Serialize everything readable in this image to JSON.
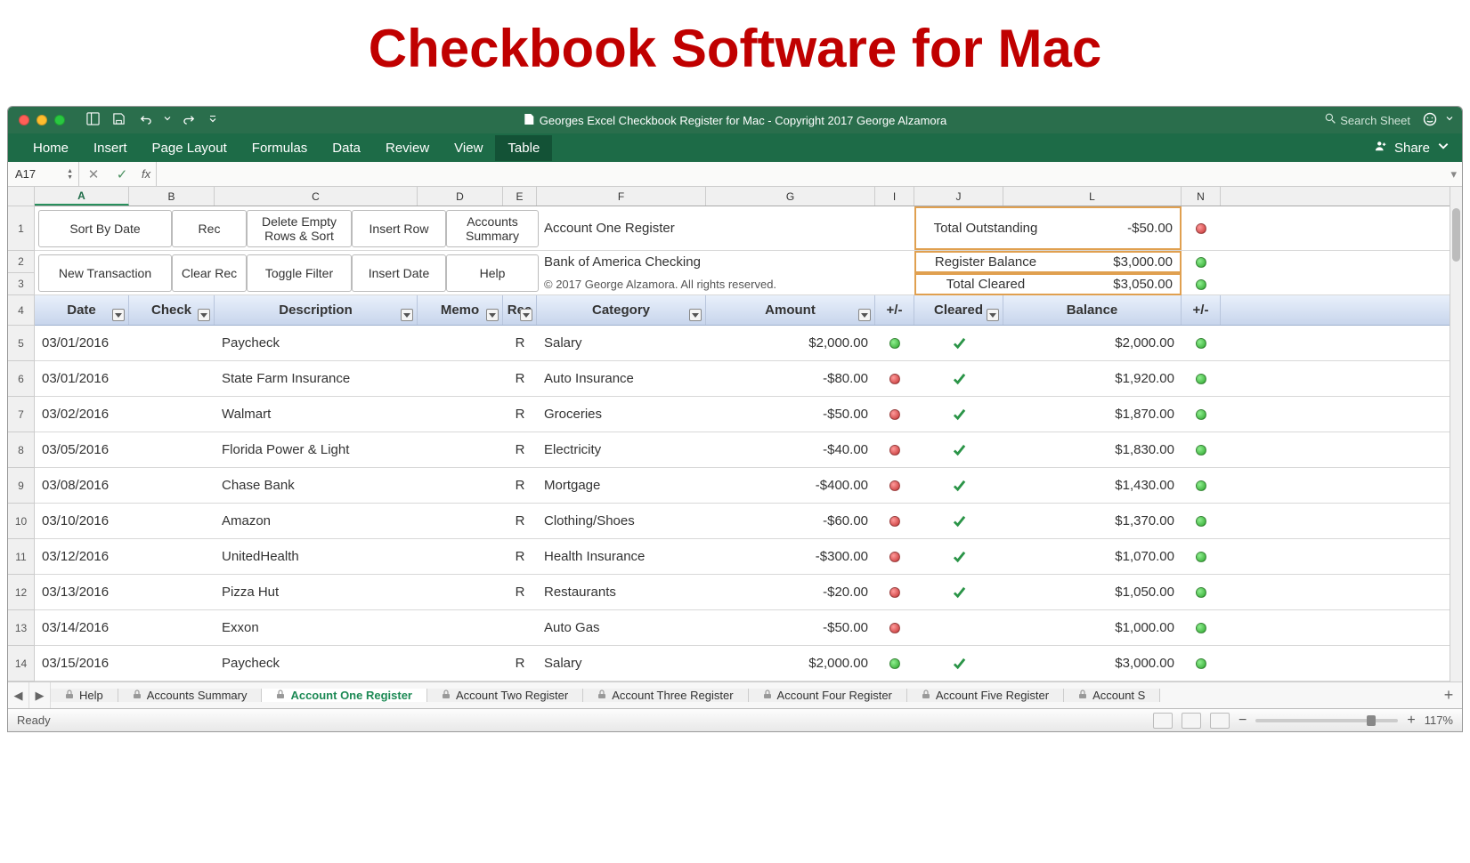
{
  "page_heading": "Checkbook Software for Mac",
  "window_title": "Georges Excel Checkbook Register for Mac - Copyright 2017 George Alzamora",
  "search_placeholder": "Search Sheet",
  "share_label": "Share",
  "ribbon_tabs": [
    "Home",
    "Insert",
    "Page Layout",
    "Formulas",
    "Data",
    "Review",
    "View",
    "Table"
  ],
  "active_ribbon_tab": "Table",
  "name_box": "A17",
  "col_headers": [
    "A",
    "B",
    "C",
    "D",
    "E",
    "F",
    "G",
    "I",
    "J",
    "L",
    "N"
  ],
  "buttons_row1": [
    "Sort By Date",
    "Rec",
    "Delete Empty Rows & Sort",
    "Insert Row",
    "Accounts Summary"
  ],
  "buttons_row2": [
    "New Transaction",
    "Clear Rec",
    "Toggle Filter",
    "Insert Date",
    "Help"
  ],
  "info_lines": {
    "title": "Account One Register",
    "bank": "Bank of America Checking",
    "copyright": "© 2017 George Alzamora.  All rights reserved."
  },
  "summary": [
    {
      "label": "Total Outstanding",
      "value": "-$50.00",
      "led": "red"
    },
    {
      "label": "Register Balance",
      "value": "$3,000.00",
      "led": "green"
    },
    {
      "label": "Total Cleared",
      "value": "$3,050.00",
      "led": "green"
    }
  ],
  "table_headers": [
    "Date",
    "Check",
    "Description",
    "Memo",
    "Rec",
    "Category",
    "Amount",
    "+/-",
    "Cleared",
    "Balance",
    "+/-"
  ],
  "rows": [
    {
      "date": "03/01/2016",
      "check": "",
      "desc": "Paycheck",
      "memo": "",
      "rec": "R",
      "cat": "Salary",
      "amt": "$2,000.00",
      "pm": "green",
      "clr": true,
      "bal": "$2,000.00",
      "pm2": "green"
    },
    {
      "date": "03/01/2016",
      "check": "",
      "desc": "State Farm Insurance",
      "memo": "",
      "rec": "R",
      "cat": "Auto Insurance",
      "amt": "-$80.00",
      "pm": "red",
      "clr": true,
      "bal": "$1,920.00",
      "pm2": "green"
    },
    {
      "date": "03/02/2016",
      "check": "",
      "desc": "Walmart",
      "memo": "",
      "rec": "R",
      "cat": "Groceries",
      "amt": "-$50.00",
      "pm": "red",
      "clr": true,
      "bal": "$1,870.00",
      "pm2": "green"
    },
    {
      "date": "03/05/2016",
      "check": "",
      "desc": "Florida Power & Light",
      "memo": "",
      "rec": "R",
      "cat": "Electricity",
      "amt": "-$40.00",
      "pm": "red",
      "clr": true,
      "bal": "$1,830.00",
      "pm2": "green"
    },
    {
      "date": "03/08/2016",
      "check": "",
      "desc": "Chase Bank",
      "memo": "",
      "rec": "R",
      "cat": "Mortgage",
      "amt": "-$400.00",
      "pm": "red",
      "clr": true,
      "bal": "$1,430.00",
      "pm2": "green"
    },
    {
      "date": "03/10/2016",
      "check": "",
      "desc": "Amazon",
      "memo": "",
      "rec": "R",
      "cat": "Clothing/Shoes",
      "amt": "-$60.00",
      "pm": "red",
      "clr": true,
      "bal": "$1,370.00",
      "pm2": "green"
    },
    {
      "date": "03/12/2016",
      "check": "",
      "desc": "UnitedHealth",
      "memo": "",
      "rec": "R",
      "cat": "Health Insurance",
      "amt": "-$300.00",
      "pm": "red",
      "clr": true,
      "bal": "$1,070.00",
      "pm2": "green"
    },
    {
      "date": "03/13/2016",
      "check": "",
      "desc": "Pizza Hut",
      "memo": "",
      "rec": "R",
      "cat": "Restaurants",
      "amt": "-$20.00",
      "pm": "red",
      "clr": true,
      "bal": "$1,050.00",
      "pm2": "green"
    },
    {
      "date": "03/14/2016",
      "check": "",
      "desc": "Exxon",
      "memo": "",
      "rec": "",
      "cat": "Auto Gas",
      "amt": "-$50.00",
      "pm": "red",
      "clr": false,
      "bal": "$1,000.00",
      "pm2": "green"
    },
    {
      "date": "03/15/2016",
      "check": "",
      "desc": "Paycheck",
      "memo": "",
      "rec": "R",
      "cat": "Salary",
      "amt": "$2,000.00",
      "pm": "green",
      "clr": true,
      "bal": "$3,000.00",
      "pm2": "green"
    }
  ],
  "row_numbers": [
    "1",
    "2",
    "3",
    "4",
    "5",
    "6",
    "7",
    "8",
    "9",
    "10",
    "11",
    "12",
    "13",
    "14"
  ],
  "sheet_tabs": [
    "Help",
    "Accounts Summary",
    "Account One Register",
    "Account Two Register",
    "Account Three Register",
    "Account Four Register",
    "Account Five Register",
    "Account S"
  ],
  "active_sheet_tab": "Account One Register",
  "status_text": "Ready",
  "zoom_text": "117%"
}
